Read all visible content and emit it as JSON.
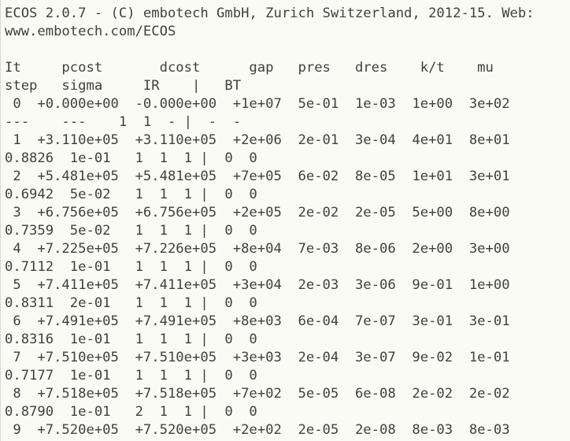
{
  "terminal": {
    "lines": [
      "ECOS 2.0.7 - (C) embotech GmbH, Zurich Switzerland, 2012-15. Web:",
      "www.embotech.com/ECOS",
      "",
      "It     pcost       dcost      gap   pres   dres    k/t    mu",
      "step   sigma     IR    |   BT",
      " 0  +0.000e+00  -0.000e+00  +1e+07  5e-01  1e-03  1e+00  3e+02",
      "---    ---    1  1  - |  -  -",
      " 1  +3.110e+05  +3.110e+05  +2e+06  2e-01  3e-04  4e+01  8e+01",
      "0.8826  1e-01   1  1  1 |  0  0",
      " 2  +5.481e+05  +5.481e+05  +7e+05  6e-02  8e-05  1e+01  3e+01",
      "0.6942  5e-02   1  1  1 |  0  0",
      " 3  +6.756e+05  +6.756e+05  +2e+05  2e-02  2e-05  5e+00  8e+00",
      "0.7359  5e-02   1  1  1 |  0  0",
      " 4  +7.225e+05  +7.226e+05  +8e+04  7e-03  8e-06  2e+00  3e+00",
      "0.7112  1e-01   1  1  1 |  0  0",
      " 5  +7.411e+05  +7.411e+05  +3e+04  2e-03  3e-06  9e-01  1e+00",
      "0.8311  2e-01   1  1  1 |  0  0",
      " 6  +7.491e+05  +7.491e+05  +8e+03  6e-04  7e-07  3e-01  3e-01",
      "0.8316  1e-01   1  1  1 |  0  0",
      " 7  +7.510e+05  +7.510e+05  +3e+03  2e-04  3e-07  9e-02  1e-01",
      "0.7177  1e-01   1  1  1 |  0  0",
      " 8  +7.518e+05  +7.518e+05  +7e+02  5e-05  6e-08  2e-02  2e-02",
      "0.8790  1e-01   2  1  1 |  0  0",
      " 9  +7.520e+05  +7.520e+05  +2e+02  2e-05  2e-08  8e-03  8e-03"
    ]
  }
}
